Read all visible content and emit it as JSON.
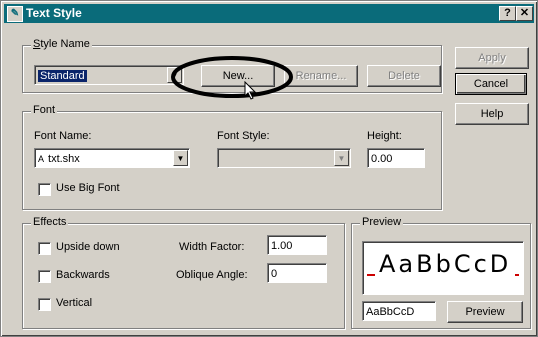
{
  "window": {
    "title": "Text Style"
  },
  "titlebar": {
    "help_btn": "?",
    "close_btn": "✕"
  },
  "style_name": {
    "group_label": "Style Name",
    "selected": "Standard",
    "new_label": "New...",
    "rename_label": "Rename...",
    "delete_label": "Delete"
  },
  "side_buttons": {
    "apply": "Apply",
    "cancel": "Cancel",
    "help": "Help"
  },
  "font": {
    "group_label": "Font",
    "name_label": "Font Name:",
    "name_value": "txt.shx",
    "style_label": "Font Style:",
    "style_value": "",
    "height_label": "Height:",
    "height_value": "0.00",
    "big_font_label": "Use Big Font"
  },
  "effects": {
    "group_label": "Effects",
    "upside_down": "Upside down",
    "backwards": "Backwards",
    "vertical": "Vertical",
    "width_factor_label": "Width Factor:",
    "width_factor_value": "1.00",
    "oblique_label": "Oblique Angle:",
    "oblique_value": "0"
  },
  "preview": {
    "group_label": "Preview",
    "sample_display": "AaBbCcD",
    "input_value": "AaBbCcD",
    "button_label": "Preview"
  }
}
